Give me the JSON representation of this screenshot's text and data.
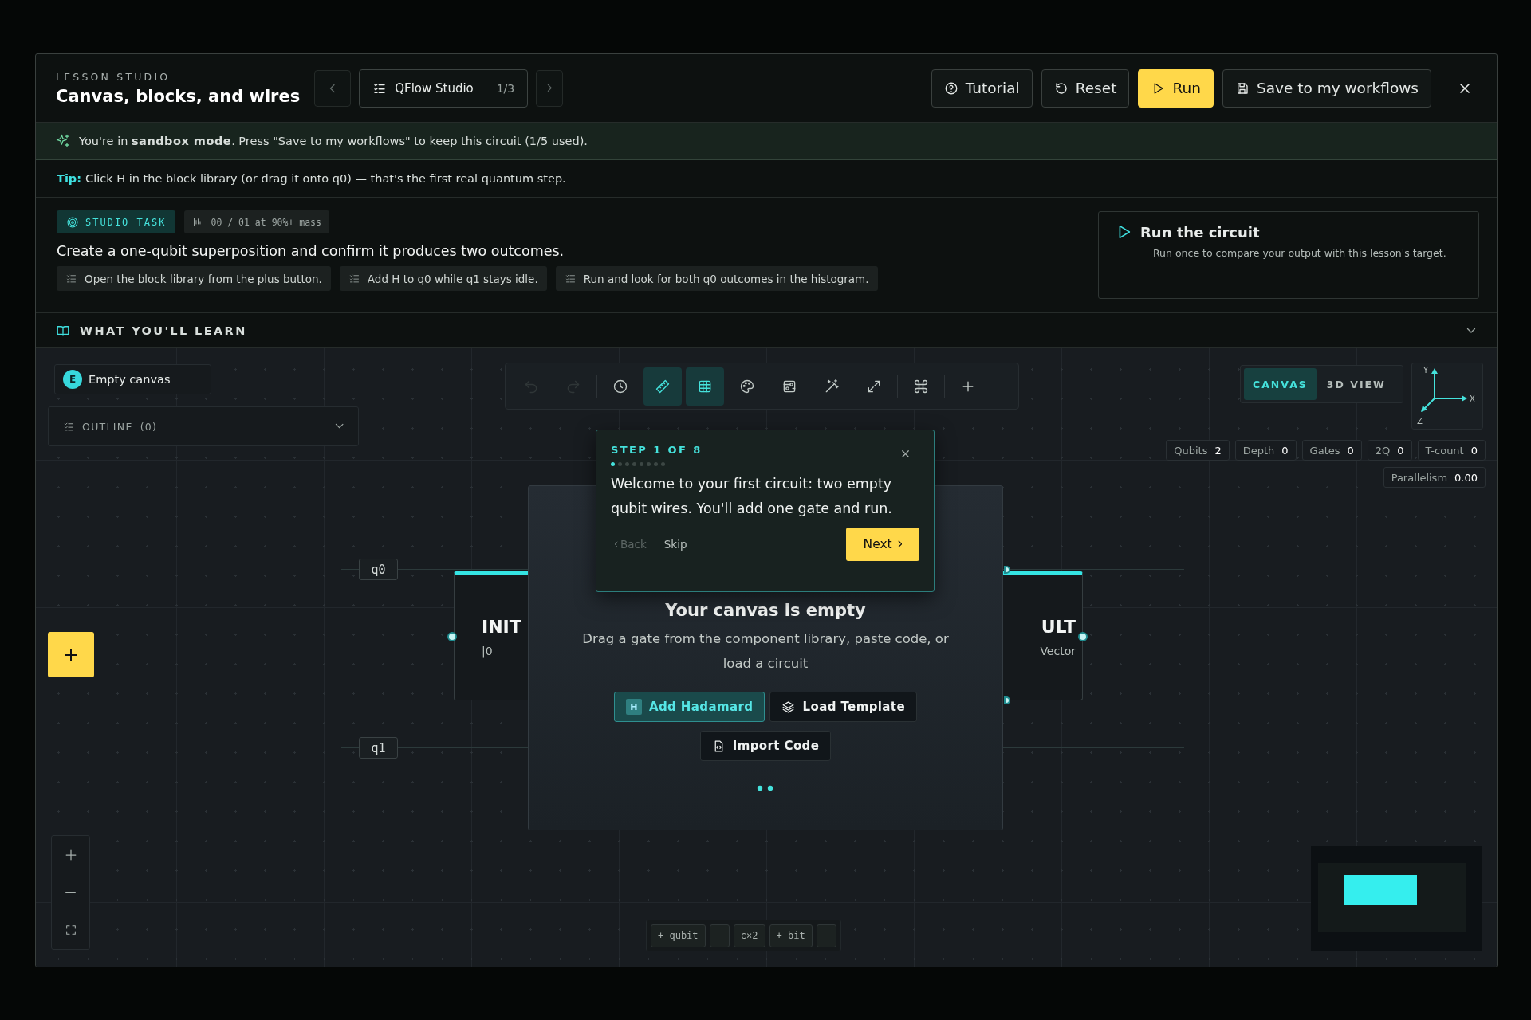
{
  "header": {
    "eyebrow": "LESSON STUDIO",
    "title": "Canvas, blocks, and wires",
    "lesson_picker": {
      "label": "QFlow Studio",
      "count": "1/3"
    },
    "buttons": [
      {
        "kind": "tutorial",
        "label": "Tutorial"
      },
      {
        "kind": "reset",
        "label": "Reset"
      },
      {
        "kind": "run",
        "label": "Run"
      },
      {
        "kind": "save",
        "label": "Save to my workflows"
      }
    ]
  },
  "banner": {
    "text": "You're in **sandbox mode**. Press \"Save to my workflows\" to keep this circuit (1/5 used)."
  },
  "tip": {
    "label": "Tip:",
    "text": "Click H in the block library (or drag it onto q0) — that's the first real quantum step."
  },
  "task": {
    "badge": "STUDIO TASK",
    "goal": "00 / 01 at 90%+ mass",
    "title": "Create a one-qubit superposition and confirm it produces two outcomes.",
    "steps": [
      "Open the block library from the plus button.",
      "Add H to q0 while q1 stays idle.",
      "Run and look for both q0 outcomes in the histogram."
    ]
  },
  "run_card": {
    "title": "Run the circuit",
    "text": "Run once to compare your output with this lesson's target."
  },
  "learn": {
    "title": "WHAT YOU'LL LEARN",
    "expanded": false
  },
  "canvas": {
    "chip": {
      "avatar": "E",
      "label": "Empty canvas"
    },
    "outline": {
      "label": "OUTLINE",
      "count": "(0)"
    },
    "toolbar": [
      {
        "kind": "undo",
        "active": false,
        "disabled": true
      },
      {
        "kind": "redo",
        "active": false,
        "disabled": true
      },
      {
        "kind": "history",
        "active": false,
        "disabled": false
      },
      {
        "kind": "ruler",
        "active": true,
        "disabled": false
      },
      {
        "kind": "grid",
        "active": true,
        "disabled": false
      },
      {
        "kind": "palette",
        "active": false,
        "disabled": false
      },
      {
        "kind": "board",
        "active": false,
        "disabled": false
      },
      {
        "kind": "wand",
        "active": false,
        "disabled": false
      },
      {
        "kind": "expand",
        "active": false,
        "disabled": false
      },
      {
        "kind": "command",
        "active": false,
        "disabled": false
      },
      {
        "kind": "add",
        "active": false,
        "disabled": false
      }
    ],
    "view_tabs": [
      {
        "label": "CANVAS",
        "selected": true
      },
      {
        "label": "3D VIEW",
        "selected": false
      }
    ],
    "axes": {
      "x": "X",
      "y": "Y",
      "z": "Z"
    },
    "stats": [
      {
        "label": "Qubits",
        "value": "2"
      },
      {
        "label": "Depth",
        "value": "0"
      },
      {
        "label": "Gates",
        "value": "0"
      },
      {
        "label": "2Q",
        "value": "0"
      },
      {
        "label": "T-count",
        "value": "0"
      }
    ],
    "parallelism": {
      "label": "Parallelism",
      "value": "0.00"
    },
    "wires": [
      {
        "label": "q0"
      },
      {
        "label": "q1"
      }
    ],
    "blocks": [
      {
        "kind": "init",
        "title": "INIT",
        "subtitle": "|0"
      },
      {
        "kind": "result",
        "title": "ULT",
        "subtitle": "Vector"
      }
    ],
    "empty_state": {
      "title": "Your canvas is empty",
      "text": "Drag a gate from the component library, paste code, or load a circuit",
      "actions": [
        {
          "kind": "hadamard",
          "badge": "H",
          "label": "Add Hadamard"
        },
        {
          "kind": "template",
          "label": "Load Template"
        },
        {
          "kind": "code",
          "label": "Import Code"
        }
      ]
    },
    "tour": {
      "step": "STEP 1 OF 8",
      "progress": [
        {
          "selected": true
        },
        {
          "selected": false
        },
        {
          "selected": false
        },
        {
          "selected": false
        },
        {
          "selected": false
        },
        {
          "selected": false
        },
        {
          "selected": false
        },
        {
          "selected": false
        }
      ],
      "text": "Welcome to your first circuit: two empty qubit wires. You'll add one gate and run.",
      "back": {
        "label": "Back",
        "disabled": true
      },
      "skip": "Skip",
      "next": "Next"
    },
    "bottom_bar": [
      "+ qubit",
      "—",
      "c×2",
      "+ bit",
      "—"
    ]
  }
}
